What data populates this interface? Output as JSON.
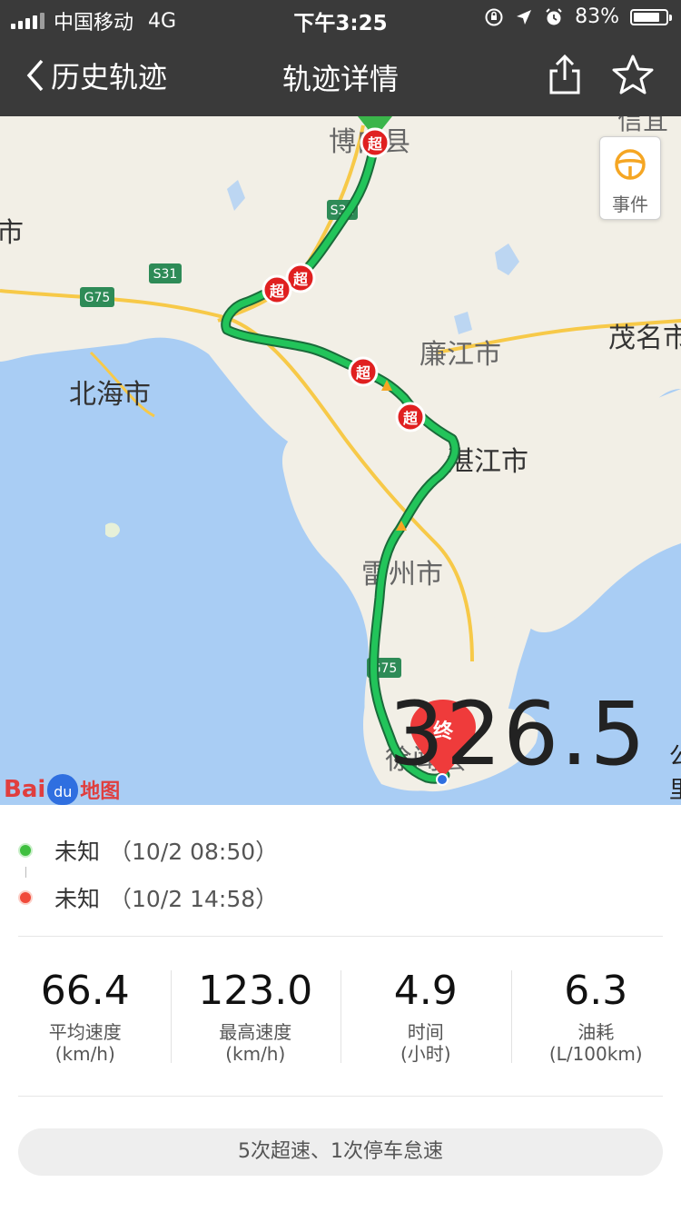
{
  "status_bar": {
    "carrier": "中国移动",
    "network": "4G",
    "time": "下午3:25",
    "battery_pct": "83%",
    "battery_level": 0.83
  },
  "nav": {
    "back_label": "历史轨迹",
    "title": "轨迹详情",
    "share_icon": "share-icon",
    "favorite_icon": "star-icon"
  },
  "map": {
    "event_button": "事件",
    "distance": {
      "value": "326.5",
      "unit": "公里"
    },
    "labels": {
      "bobai": "博白县",
      "beihai": "北海市",
      "lianjiang": "廉江市",
      "maoming": "茂名市",
      "zhanjiang": "湛江市",
      "leizhou": "雷州市",
      "xuwen": "徐闻县",
      "left_edge": "市",
      "top_right": "信宜"
    },
    "road_shields": [
      "S31",
      "G75",
      "S31",
      "G75"
    ],
    "overspeed_marker": "超",
    "end_marker": "终",
    "logo": {
      "bai": "Bai",
      "du": "du",
      "ditu": "地图"
    }
  },
  "route": {
    "start": {
      "place": "未知",
      "time": "（10/2 08:50）"
    },
    "end": {
      "place": "未知",
      "time": "（10/2 14:58）"
    }
  },
  "stats": [
    {
      "value": "66.4",
      "label": "平均速度",
      "unit": "(km/h)"
    },
    {
      "value": "123.0",
      "label": "最高速度",
      "unit": "(km/h)"
    },
    {
      "value": "4.9",
      "label": "时间",
      "unit": "(小时)"
    },
    {
      "value": "6.3",
      "label": "油耗",
      "unit": "(L/100km)"
    }
  ],
  "summary": "5次超速、1次停车怠速",
  "colors": {
    "bar": "#3a3a3a",
    "route": "#22c45a",
    "route_outline": "#1a6b3a",
    "start": "#3fbf3f",
    "end": "#f04a3a",
    "sea": "#a9cdf4",
    "land": "#f2efe6"
  }
}
